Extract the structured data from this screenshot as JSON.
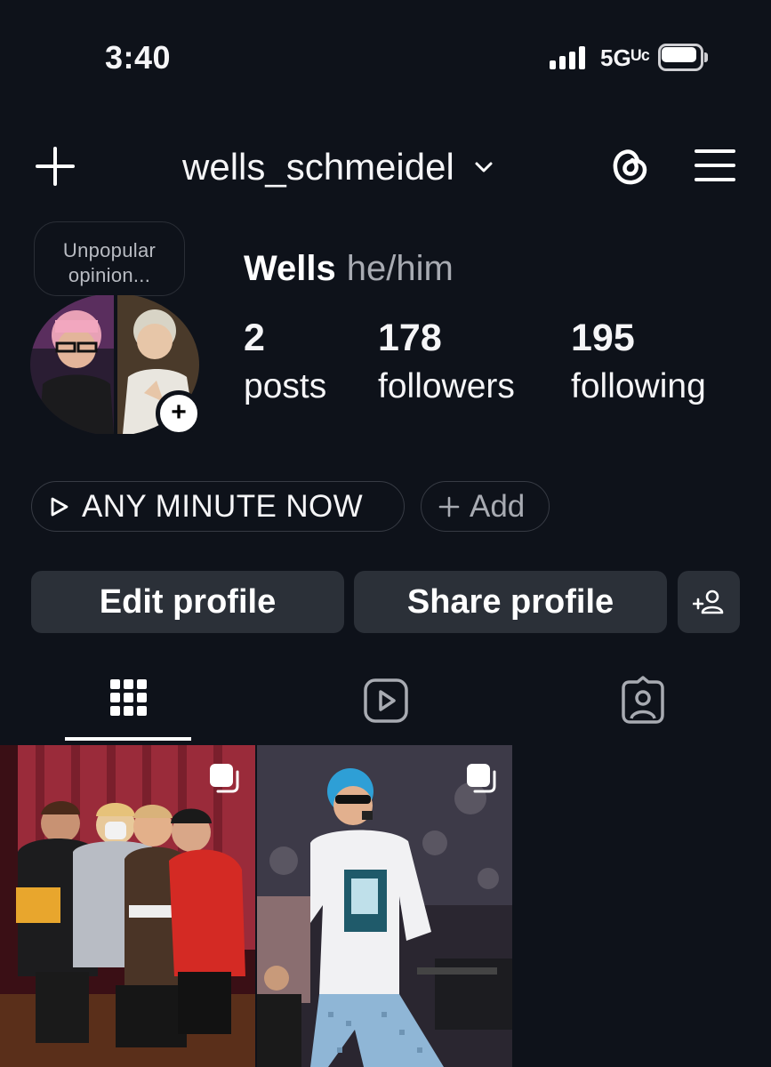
{
  "status_bar": {
    "time": "3:40",
    "network": "5Gᵁᶜ"
  },
  "header": {
    "username": "wells_schmeidel"
  },
  "profile": {
    "note": [
      "Unpopular",
      "opinion..."
    ],
    "name": "Wells",
    "pronouns": "he/him",
    "stats": [
      {
        "value": "2",
        "label": "posts"
      },
      {
        "value": "178",
        "label": "followers"
      },
      {
        "value": "195",
        "label": "following"
      }
    ]
  },
  "highlights": {
    "story_label": "ANY MINUTE NOW",
    "add_label": "Add"
  },
  "actions": {
    "edit_label": "Edit profile",
    "share_label": "Share profile"
  },
  "tabs": [
    {
      "icon": "grid-icon",
      "active": true
    },
    {
      "icon": "reels-icon",
      "active": false
    },
    {
      "icon": "tagged-icon",
      "active": false
    }
  ],
  "posts": [
    {
      "icon": "multi-photo-icon"
    },
    {
      "icon": "multi-photo-icon"
    }
  ],
  "colors": {
    "background": "#0e121a",
    "button": "#2b3038",
    "muted_text": "#a8abb2"
  }
}
